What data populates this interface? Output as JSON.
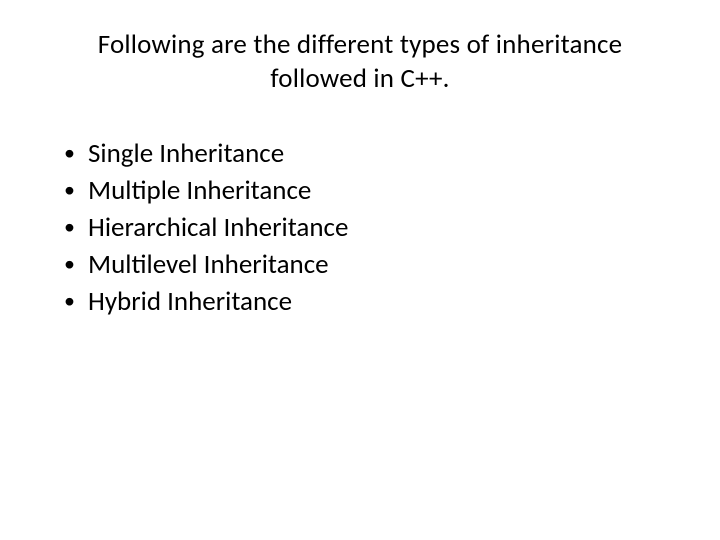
{
  "title": "Following are the different types of inheritance followed in C++.",
  "items": [
    "Single Inheritance",
    "Multiple Inheritance",
    "Hierarchical Inheritance",
    "Multilevel Inheritance",
    "Hybrid Inheritance"
  ]
}
